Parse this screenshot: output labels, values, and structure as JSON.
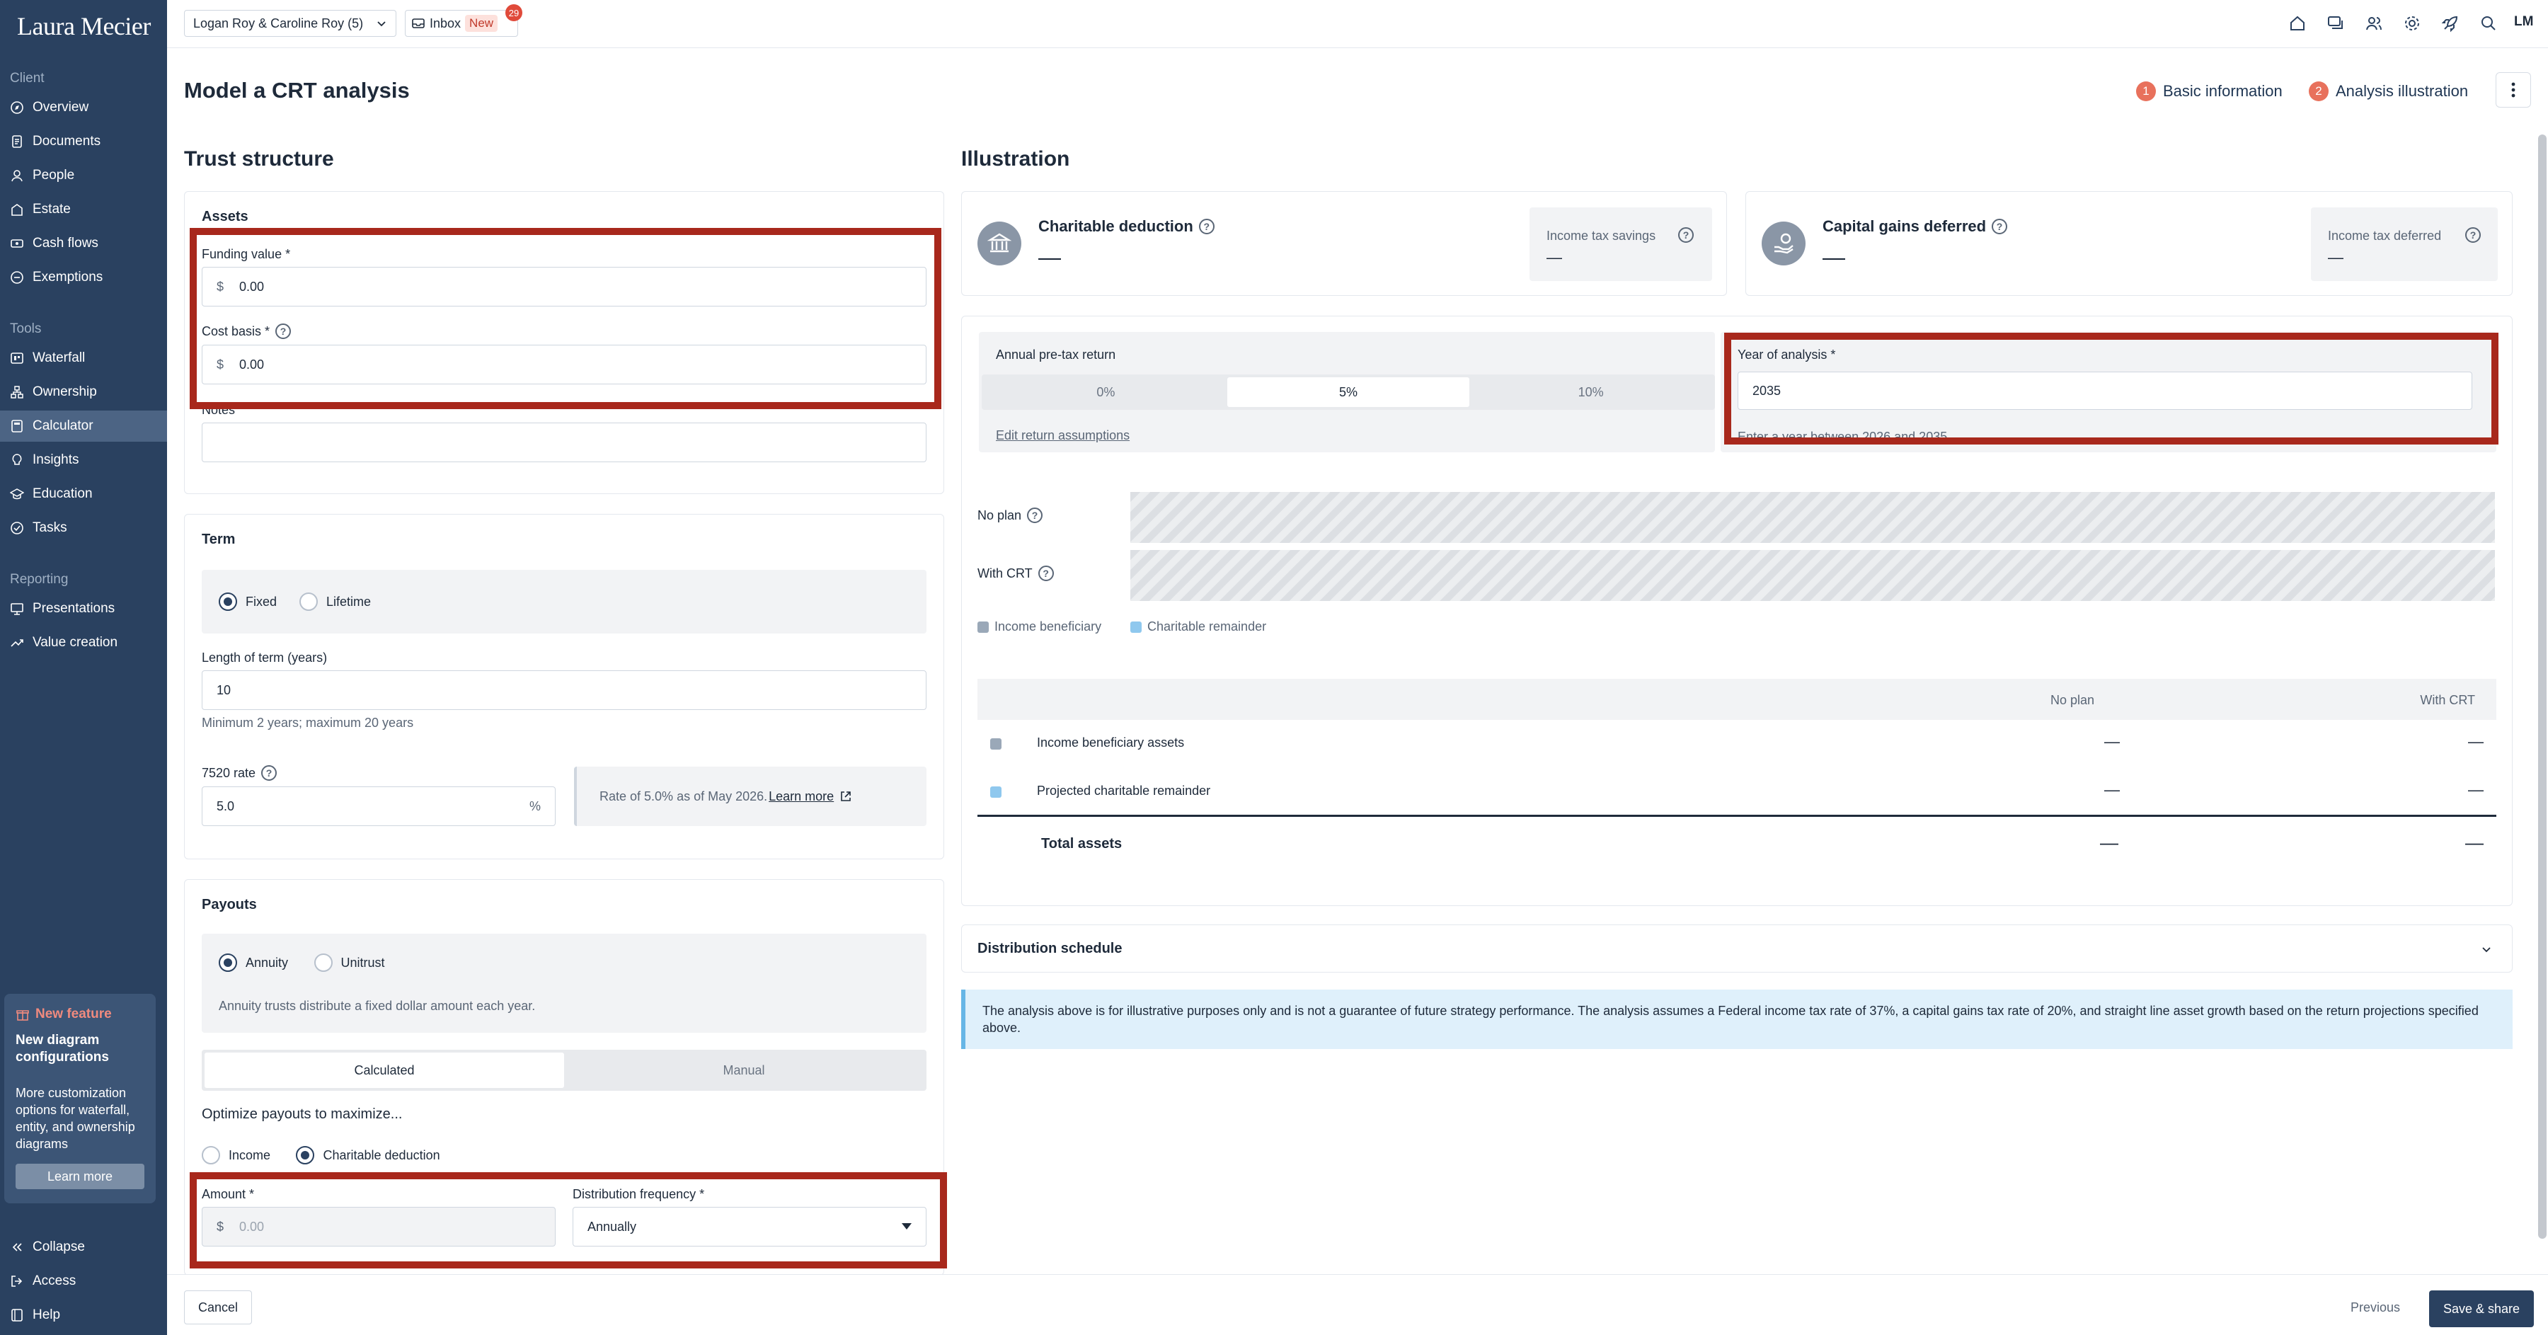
{
  "app": {
    "logo": "Laura Mecier",
    "initials": "LM"
  },
  "topbar": {
    "client": "Logan Roy & Caroline Roy (5)",
    "inbox_label": "Inbox",
    "inbox_badge": "New",
    "inbox_count": "29"
  },
  "sidebar": {
    "client_label": "Client",
    "client_items": [
      "Overview",
      "Documents",
      "People",
      "Estate",
      "Cash flows",
      "Exemptions"
    ],
    "tools_label": "Tools",
    "tools_items": [
      "Waterfall",
      "Ownership",
      "Calculator",
      "Insights",
      "Education",
      "Tasks"
    ],
    "reporting_label": "Reporting",
    "reporting_items": [
      "Presentations",
      "Value creation"
    ],
    "feature": {
      "tag": "New feature",
      "title": "New diagram configurations",
      "desc": "More customization options for waterfall, entity, and ownership diagrams",
      "button": "Learn more"
    },
    "bottom_items": [
      "Collapse",
      "Access",
      "Help"
    ]
  },
  "page": {
    "title": "Model a CRT analysis",
    "steps": [
      {
        "num": "1",
        "label": "Basic information"
      },
      {
        "num": "2",
        "label": "Analysis illustration"
      }
    ]
  },
  "trust": {
    "heading": "Trust structure",
    "assets_title": "Assets",
    "funding_label": "Funding value *",
    "funding_prefix": "$",
    "funding_value": "0.00",
    "cost_label": "Cost basis *",
    "cost_prefix": "$",
    "cost_value": "0.00",
    "notes_label": "Notes",
    "term_title": "Term",
    "term_fixed": "Fixed",
    "term_lifetime": "Lifetime",
    "length_label": "Length of term (years)",
    "length_value": "10",
    "length_help": "Minimum 2 years; maximum 20 years",
    "rate_label": "7520 rate",
    "rate_value": "5.0",
    "rate_suffix": "%",
    "rate_info": "Rate of 5.0% as of May 2026.",
    "rate_link": "Learn more",
    "payouts_title": "Payouts",
    "annuity": "Annuity",
    "unitrust": "Unitrust",
    "payout_desc": "Annuity trusts distribute a fixed dollar amount each year.",
    "calc_tab": "Calculated",
    "manual_tab": "Manual",
    "optimize_title": "Optimize payouts to maximize...",
    "opt_income": "Income",
    "opt_charitable": "Charitable deduction",
    "amount_label": "Amount *",
    "amount_prefix": "$",
    "amount_placeholder": "0.00",
    "freq_label": "Distribution frequency *",
    "freq_value": "Annually"
  },
  "illustration": {
    "heading": "Illustration",
    "charitable_title": "Charitable deduction",
    "charitable_value": "—",
    "tax_savings_label": "Income tax savings",
    "tax_savings_value": "—",
    "cap_gains_title": "Capital gains deferred",
    "cap_gains_value": "—",
    "tax_deferred_label": "Income tax deferred",
    "tax_deferred_value": "—",
    "return_label": "Annual pre-tax return",
    "return_options": [
      "0%",
      "5%",
      "10%"
    ],
    "return_selected": "5%",
    "edit_assumptions": "Edit return assumptions",
    "year_label": "Year of analysis *",
    "year_value": "2035",
    "year_help": "Enter a year between 2026 and 2035",
    "no_plan_label": "No plan",
    "with_crt_label": "With CRT",
    "legend_income": "Income beneficiary",
    "legend_charitable": "Charitable remainder",
    "col_no_plan": "No plan",
    "col_with_crt": "With CRT",
    "rows": [
      {
        "label": "Income beneficiary assets",
        "no_plan": "—",
        "with_crt": "—"
      },
      {
        "label": "Projected charitable remainder",
        "no_plan": "—",
        "with_crt": "—"
      }
    ],
    "total_label": "Total assets",
    "total_no_plan": "—",
    "total_with_crt": "—",
    "distribution_title": "Distribution schedule",
    "disclaimer": "The analysis above is for illustrative purposes only and is not a guarantee of future strategy performance. The analysis assumes a Federal income tax rate of 37%, a capital gains tax rate of 20%, and straight line asset growth based on the return projections specified above."
  },
  "footer": {
    "cancel": "Cancel",
    "previous": "Previous",
    "save": "Save & share"
  },
  "colors": {
    "sidebar": "#2a4160",
    "accent": "#e8715c",
    "highlight": "#a8281c",
    "income_legend": "#9aa8b8",
    "charitable_legend": "#8fc8ee"
  }
}
